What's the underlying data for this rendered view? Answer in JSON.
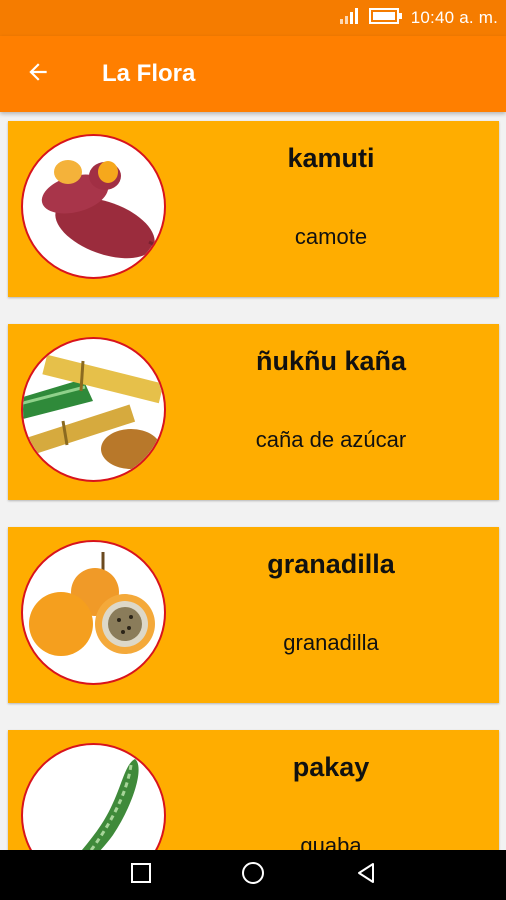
{
  "status_bar": {
    "time": "10:40 a. m."
  },
  "app_bar": {
    "title": "La Flora"
  },
  "items": [
    {
      "word": "kamuti",
      "meaning": "camote",
      "image": "sweet-potato"
    },
    {
      "word": "ñukñu kaña",
      "meaning": "caña de azúcar",
      "image": "sugar-cane"
    },
    {
      "word": "granadilla",
      "meaning": "granadilla",
      "image": "granadilla"
    },
    {
      "word": "pakay",
      "meaning": "guaba",
      "image": "guaba-pod"
    }
  ],
  "colors": {
    "status_bar": "#f57c00",
    "app_bar": "#ff7f00",
    "card": "#ffad00",
    "thumb_border": "#d8131c",
    "nav_bar": "#000000"
  }
}
